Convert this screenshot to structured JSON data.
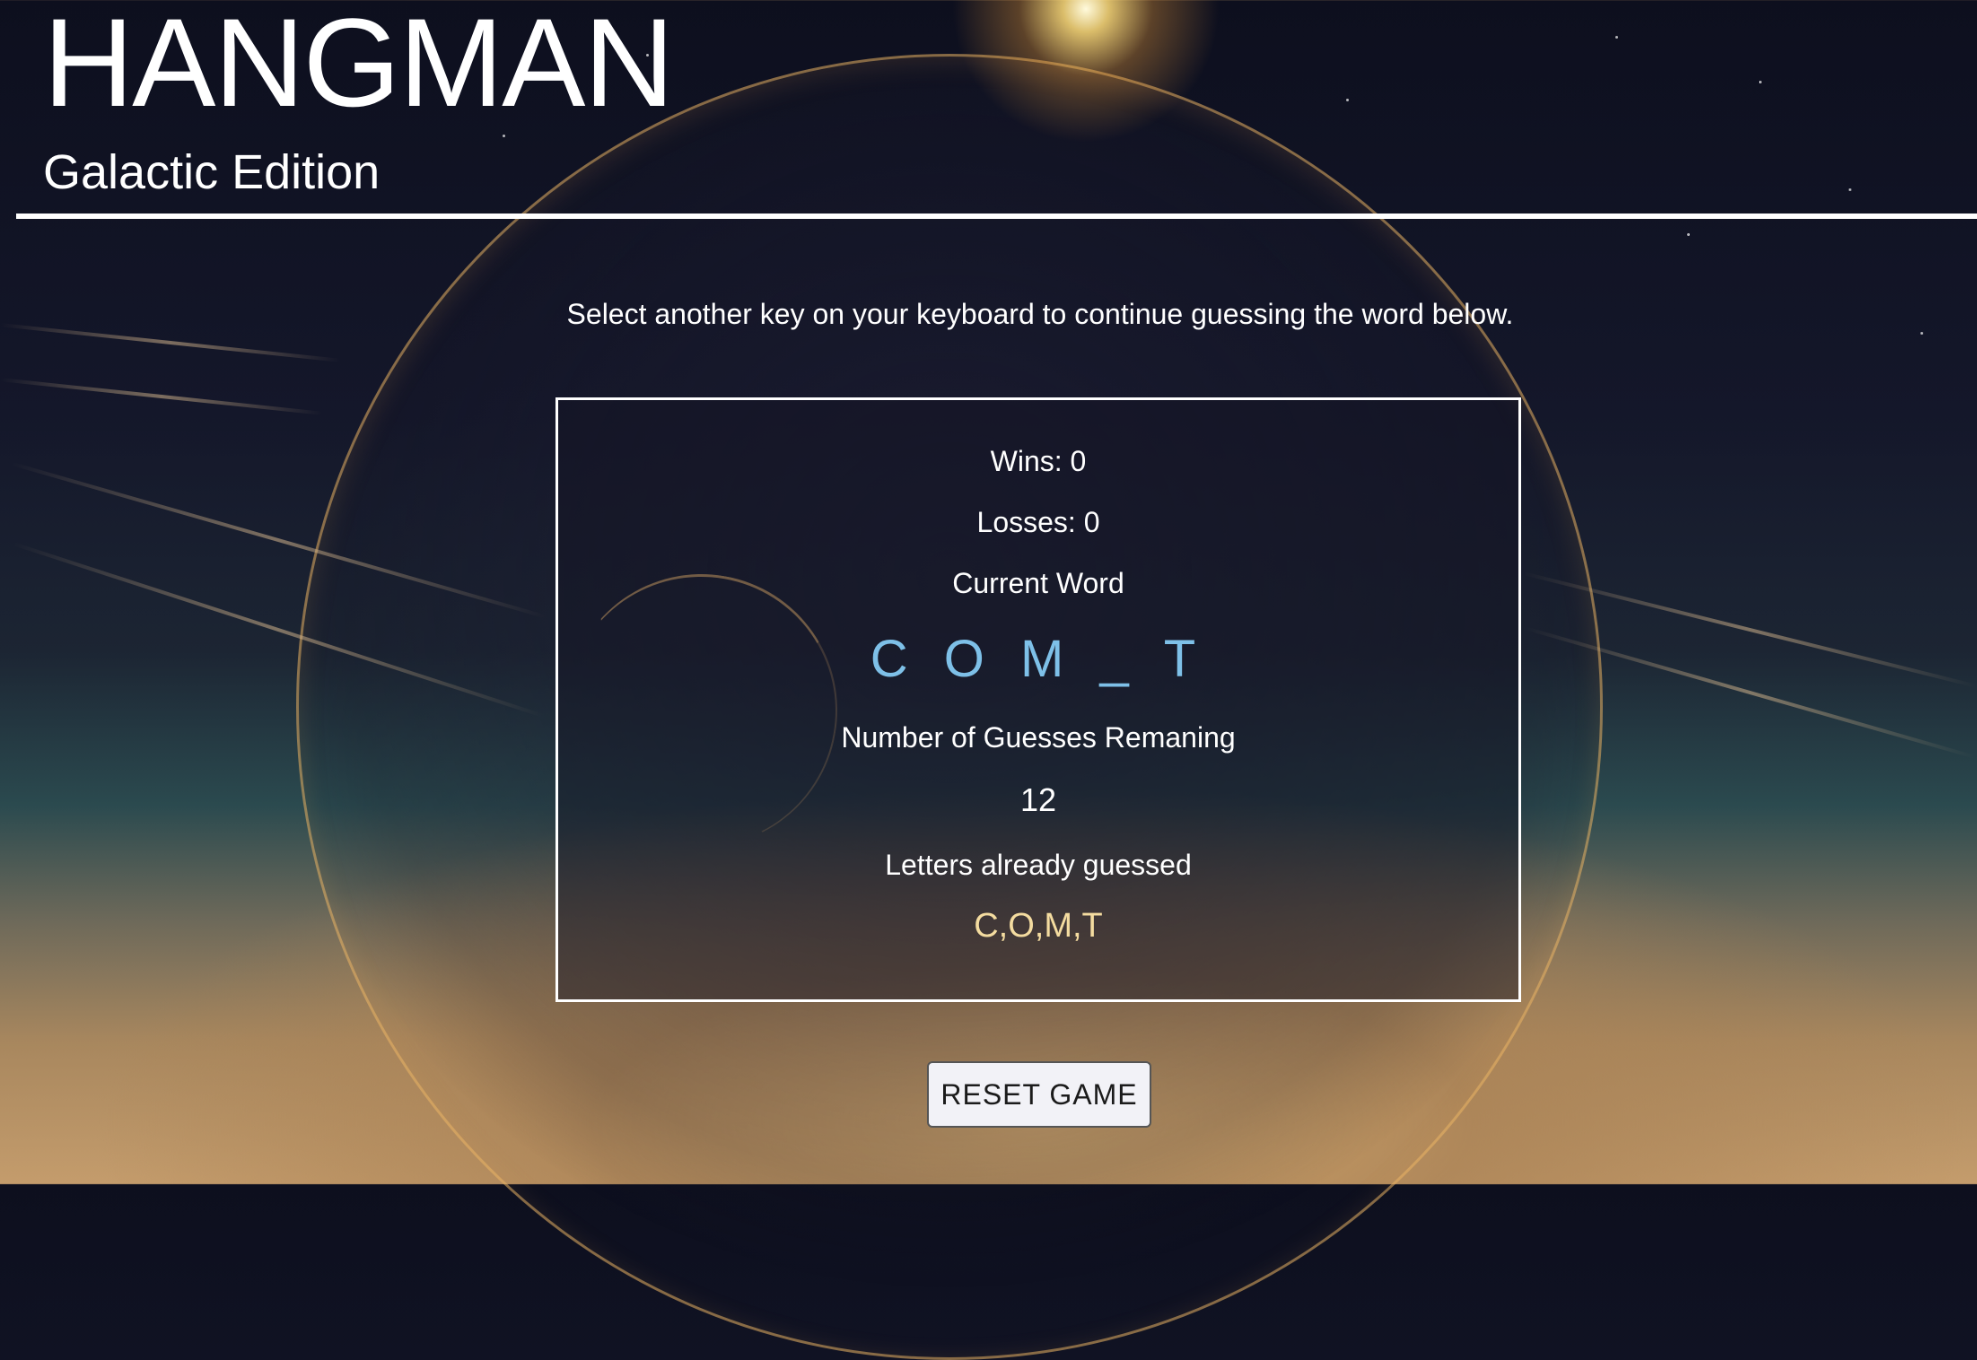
{
  "header": {
    "title": "HANGMAN",
    "subtitle": "Galactic Edition"
  },
  "instructions": "Select another key on your keyboard to continue guessing the word below.",
  "game": {
    "wins_text": "Wins: 0",
    "losses_text": "Losses: 0",
    "current_word_label": "Current Word",
    "current_word": "C O M _ T",
    "guesses_label": "Number of Guesses Remaning",
    "guesses_remaining": "12",
    "letters_label": "Letters already guessed",
    "letters_guessed": "C,O,M,T"
  },
  "controls": {
    "reset_label": "RESET GAME"
  },
  "colors": {
    "word_color": "#7ec0e8",
    "letters_color": "#f4dca0"
  }
}
